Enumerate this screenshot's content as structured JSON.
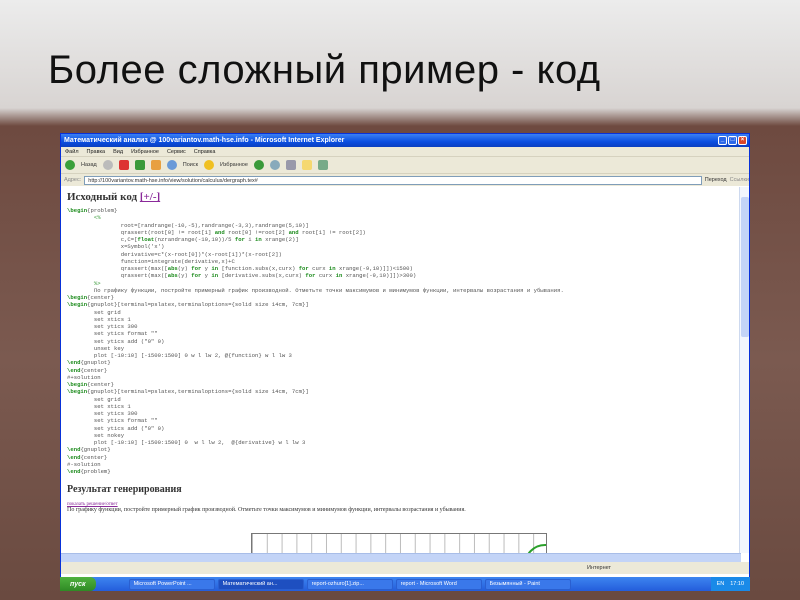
{
  "slide": {
    "title": "Более сложный пример - код"
  },
  "window": {
    "title": "Математический анализ @ 100variantov.math-hse.info - Microsoft Internet Explorer",
    "menu": [
      "Файл",
      "Правка",
      "Вид",
      "Избранное",
      "Сервис",
      "Справка"
    ],
    "toolbar": {
      "back": "Назад",
      "search": "Поиск",
      "favorites": "Избранное"
    },
    "address": {
      "label": "Адрес:",
      "url": "http://100variantov.math-hse.info/view/solution/calculus/dergraph.tex#",
      "go": "Переход",
      "links": "Ссылки"
    }
  },
  "page": {
    "source_heading": "Исходный код",
    "toggle": "[+/-]",
    "code": [
      [
        [
          "\\begin",
          "kw"
        ],
        [
          "{problem}",
          ""
        ]
      ],
      [
        [
          "        ",
          ""
        ],
        [
          "<%",
          "gr"
        ]
      ],
      [
        [
          "                root=[randrange(-10,-5),randrange(-3,3),randrange(5,10)]",
          ""
        ]
      ],
      [
        [
          "                qrassert(root[0] != root[1] ",
          ""
        ],
        [
          "and",
          "kw"
        ],
        [
          " root[0] !=root[2] ",
          ""
        ],
        [
          "and",
          "kw"
        ],
        [
          " root[1] != root[2])",
          ""
        ]
      ],
      [
        [
          "                c,C=[",
          ""
        ],
        [
          "float",
          "kw"
        ],
        [
          "(nzrandrange(-10,10))/5 ",
          ""
        ],
        [
          "for",
          "kw"
        ],
        [
          " i ",
          ""
        ],
        [
          "in",
          "kw"
        ],
        [
          " xrange(2)]",
          ""
        ]
      ],
      [
        [
          "                x=Symbol('x')",
          ""
        ]
      ],
      [
        [
          "                derivative=c*(x-root[0])*(x-root[1])*(x-root[2])",
          ""
        ]
      ],
      [
        [
          "                function=integrate(derivative,x)+C",
          ""
        ]
      ],
      [
        [
          "                qrassert(max([",
          ""
        ],
        [
          "abs",
          "kw"
        ],
        [
          "(y) ",
          ""
        ],
        [
          "for",
          "kw"
        ],
        [
          " y ",
          ""
        ],
        [
          "in",
          "kw"
        ],
        [
          " [function.subs(x,curx) ",
          ""
        ],
        [
          "for",
          "kw"
        ],
        [
          " curx ",
          ""
        ],
        [
          "in",
          "kw"
        ],
        [
          " xrange(-9,10)]])<1500)",
          ""
        ]
      ],
      [
        [
          "                qrassert(max([",
          ""
        ],
        [
          "abs",
          "kw"
        ],
        [
          "(y) ",
          ""
        ],
        [
          "for",
          "kw"
        ],
        [
          " y ",
          ""
        ],
        [
          "in",
          "kw"
        ],
        [
          " [derivative.subs(x,curx) ",
          ""
        ],
        [
          "for",
          "kw"
        ],
        [
          " curx ",
          ""
        ],
        [
          "in",
          "kw"
        ],
        [
          " xrange(-9,10)]])>300)",
          ""
        ]
      ],
      [
        [
          "        ",
          ""
        ],
        [
          "%>",
          "gr"
        ]
      ],
      [
        [
          "        По графику функции, постройте примерный график производной. Отметьте точки максимумов и минимумов функции, интервалы возрастания и убывания.",
          ""
        ]
      ],
      [
        [
          "\\begin",
          "kw"
        ],
        [
          "{center}",
          ""
        ]
      ],
      [
        [
          "\\begin",
          "kw"
        ],
        [
          "{gnuplot}[terminal=pslatex,terminaloptions={solid size 14cm, 7cm}]",
          ""
        ]
      ],
      [
        [
          "        set grid",
          ""
        ]
      ],
      [
        [
          "        set xtics 1",
          ""
        ]
      ],
      [
        [
          "        set ytics 300",
          ""
        ]
      ],
      [
        [
          "        set ytics format \"\"",
          ""
        ]
      ],
      [
        [
          "        set ytics add (\"0\" 0)",
          ""
        ]
      ],
      [
        [
          "        unset key",
          ""
        ]
      ],
      [
        [
          "        plot [-10:10] [-1500:1500] 0 w l lw 2, @{function} w l lw 3",
          ""
        ]
      ],
      [
        [
          "\\end",
          "kw"
        ],
        [
          "{gnuplot}",
          ""
        ]
      ],
      [
        [
          "\\end",
          "kw"
        ],
        [
          "{center}",
          ""
        ]
      ],
      [
        [
          "#+solution",
          ""
        ]
      ],
      [
        [
          "\\begin",
          "kw"
        ],
        [
          "{center}",
          ""
        ]
      ],
      [
        [
          "\\begin",
          "kw"
        ],
        [
          "{gnuplot}[terminal=pslatex,terminaloptions={solid size 14cm, 7cm}]",
          ""
        ]
      ],
      [
        [
          "        set grid",
          ""
        ]
      ],
      [
        [
          "        set xtics 1",
          ""
        ]
      ],
      [
        [
          "        set ytics 300",
          ""
        ]
      ],
      [
        [
          "        set ytics format \"\"",
          ""
        ]
      ],
      [
        [
          "        set ytics add (\"0\" 0)",
          ""
        ]
      ],
      [
        [
          "        set nokey",
          ""
        ]
      ],
      [
        [
          "        plot [-10:10] [-1500:1500] 0  w l lw 2,  @{derivative} w l lw 3",
          ""
        ]
      ],
      [
        [
          "\\end",
          "kw"
        ],
        [
          "{gnuplot}",
          ""
        ]
      ],
      [
        [
          "\\end",
          "kw"
        ],
        [
          "{center}",
          ""
        ]
      ],
      [
        [
          "#-solution",
          ""
        ]
      ],
      [
        [
          "\\end",
          "kw"
        ],
        [
          "{problem}",
          ""
        ]
      ]
    ],
    "result_heading": "Результат генерирования",
    "show_solution": "показать решение/ответ",
    "problem_text": "По графику функции, постройте примерный график производной. Отметьте точки максимумов и минимумов функции, интервалы возрастания и убывания."
  },
  "status": {
    "zone": "Интернет"
  },
  "taskbar": {
    "start": "пуск",
    "tasks": [
      "Microsoft PowerPoint ...",
      "Математический ан...",
      "report-ozhuro[1].zip...",
      "report - Microsoft Word",
      "Безымянный - Paint"
    ],
    "lang": "EN",
    "clock": "17:10"
  }
}
